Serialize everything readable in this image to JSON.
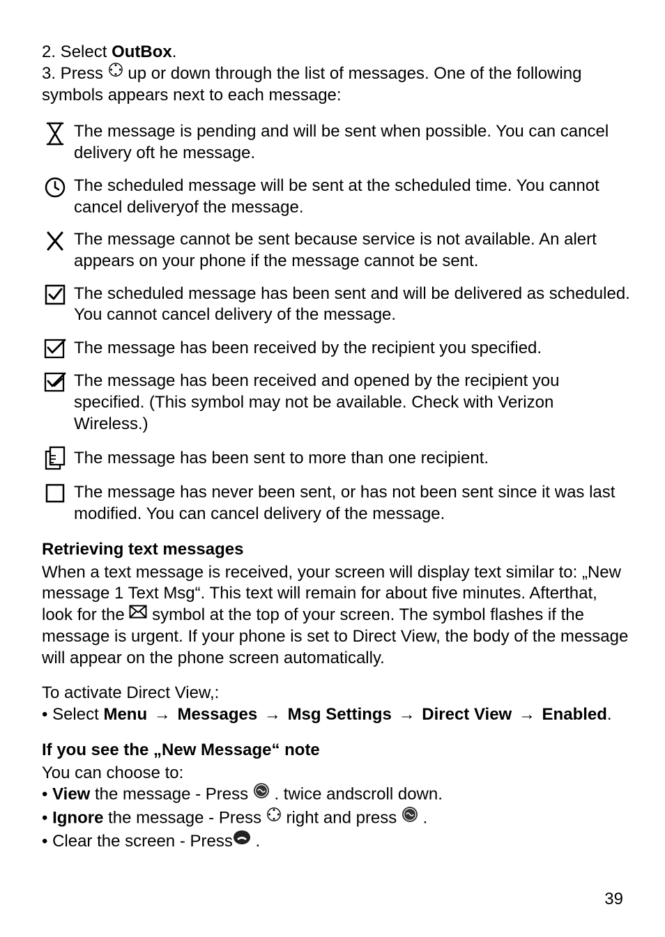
{
  "intro": {
    "step2_prefix": "2. Select ",
    "step2_bold": "OutBox",
    "step2_suffix": ".",
    "step3_before": "3. Press ",
    "step3_after": " up or down through the list of messages. One of the following symbols appears next to each message:"
  },
  "symbols": [
    "The message is pending and will be sent when possible. You can cancel delivery oft he message.",
    "The scheduled message will be sent at the scheduled time. You cannot cancel deliveryof the message.",
    "The message cannot be sent because service is not available. An alert appears on your phone if the message cannot be sent.",
    "The scheduled message has been sent and will be delivered as scheduled. You cannot cancel delivery of the message.",
    "The message has been received by the recipient you specified.",
    "The message has been received and opened by the recipient you specified. (This symbol may not be available. Check with Verizon Wireless.)",
    "The message has been sent to more than one recipient.",
    "The message has never been sent, or has not been sent since it was last  modified. You can cancel delivery of the message."
  ],
  "retrieve": {
    "heading": "Retrieving text messages",
    "para_before": "When a text message is received, your screen will display text similar to: „New message 1 Text Msg“. This text will remain for about five minutes. Afterthat, look for the ",
    "para_after": " symbol at the top of your screen. The symbol flashes if the message is urgent. If your phone is set to Direct View, the body of the message will appear on the phone screen automatically.",
    "activate_intro": "To activate Direct View,:",
    "activate_line_prefix": "• Select ",
    "menu_path": [
      "Menu",
      "Messages",
      "Msg Settings",
      "Direct View",
      "Enabled"
    ],
    "arrow": "→"
  },
  "newmsg": {
    "heading": "If you see the „New Message“ note",
    "intro": "You can choose to:",
    "view_prefix": "• ",
    "view_bold": "View",
    "view_mid": " the message - Press ",
    "view_after": " . twice andscroll down.",
    "ignore_prefix": "• ",
    "ignore_bold": "Ignore",
    "ignore_mid": " the message - Press ",
    "ignore_mid2": " right and press ",
    "ignore_after": " .",
    "clear_before": "• Clear the screen - Press",
    "clear_after": " ."
  },
  "page_number": "39"
}
